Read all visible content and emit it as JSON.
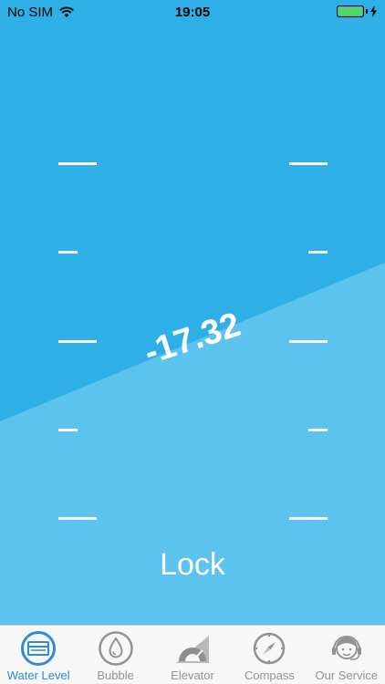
{
  "status_bar": {
    "carrier": "No SIM",
    "time": "19:05",
    "wifi_icon": "wifi-icon",
    "battery_icon": "battery-charging-icon",
    "battery_level": 1.0
  },
  "level": {
    "reading": "-17.32"
  },
  "lock_label": "Lock",
  "tabs": [
    {
      "label": "Water Level",
      "icon": "water-level-icon",
      "active": true
    },
    {
      "label": "Bubble",
      "icon": "bubble-icon",
      "active": false
    },
    {
      "label": "Elevator",
      "icon": "protractor-icon",
      "active": false
    },
    {
      "label": "Compass",
      "icon": "compass-icon",
      "active": false
    },
    {
      "label": "Our Service",
      "icon": "support-agent-icon",
      "active": false
    }
  ],
  "colors": {
    "background": "#2EAFE6",
    "water": "#5BC3EE",
    "tab_active": "#2E8BD6",
    "tab_inactive": "#929292"
  }
}
